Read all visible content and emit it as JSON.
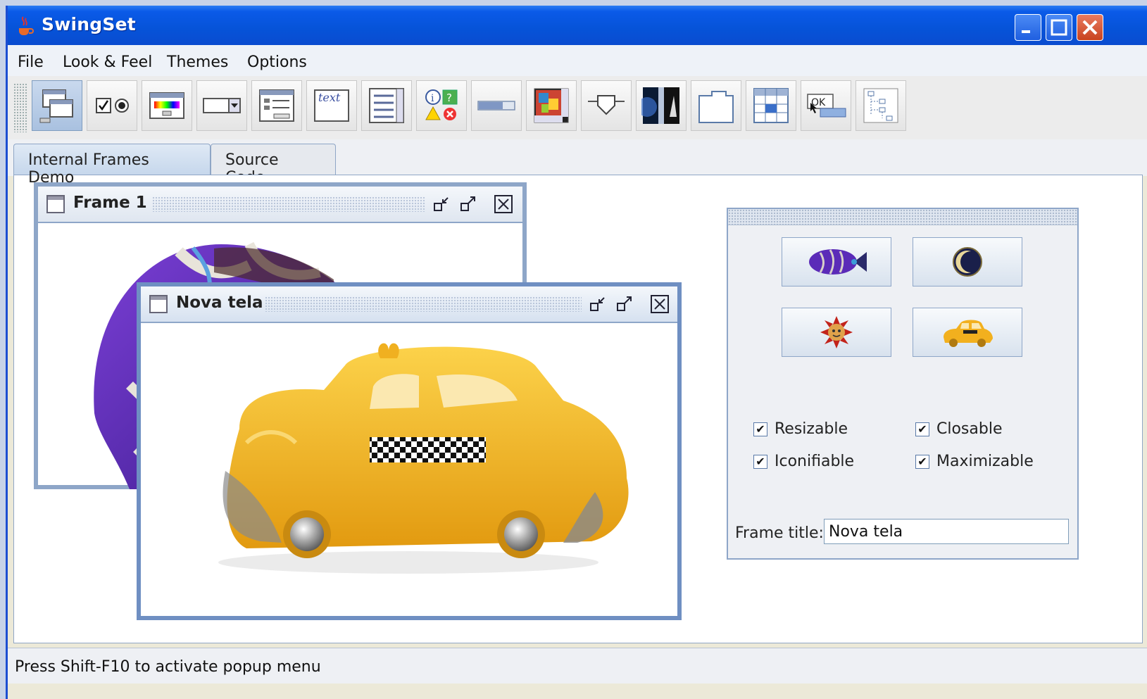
{
  "window": {
    "title": "SwingSet"
  },
  "menu": [
    "File",
    "Look & Feel",
    "Themes",
    "Options"
  ],
  "toolbar": [
    {
      "icon": "internal-frames-icon"
    },
    {
      "icon": "checkbox-radio-icon"
    },
    {
      "icon": "color-chooser-icon"
    },
    {
      "icon": "combobox-icon"
    },
    {
      "icon": "file-chooser-icon"
    },
    {
      "icon": "text-field-icon",
      "label": "text"
    },
    {
      "icon": "list-icon"
    },
    {
      "icon": "option-pane-icon"
    },
    {
      "icon": "progress-bar-icon"
    },
    {
      "icon": "scroll-pane-icon"
    },
    {
      "icon": "slider-icon"
    },
    {
      "icon": "split-pane-icon"
    },
    {
      "icon": "tabbed-pane-icon"
    },
    {
      "icon": "table-icon"
    },
    {
      "icon": "tooltip-icon",
      "label": "OK"
    },
    {
      "icon": "tree-icon"
    }
  ],
  "tabs": [
    "Internal Frames Demo",
    "Source Code"
  ],
  "frames": {
    "frame1": {
      "title": "Frame 1"
    },
    "frame2": {
      "title": "Nova tela"
    }
  },
  "controls": {
    "image_buttons": [
      "fish-icon",
      "moon-icon",
      "sun-icon",
      "taxi-icon"
    ],
    "resizable": "Resizable",
    "closable": "Closable",
    "iconifiable": "Iconifiable",
    "maximizable": "Maximizable",
    "frame_title_label": "Frame title:",
    "frame_title_value": "Nova tela"
  },
  "status": "Press Shift-F10 to activate popup menu",
  "colors": {
    "titlebar": "#0653d8",
    "frame_border": "#8ea6c8",
    "taxi_yellow": "#f2b01e"
  }
}
